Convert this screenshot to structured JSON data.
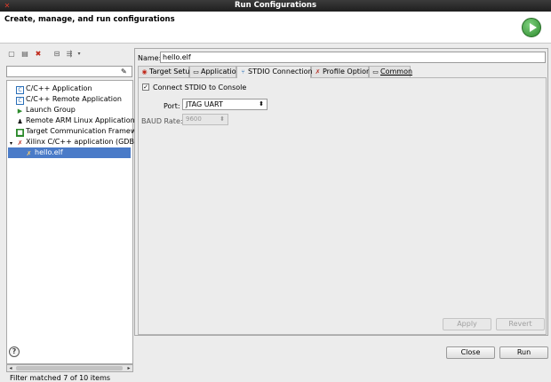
{
  "window": {
    "title": "Run Configurations"
  },
  "banner": {
    "heading": "Create, manage, and run configurations"
  },
  "filter": {
    "value": "",
    "status": "Filter matched 7 of 10 items"
  },
  "tree": {
    "items": [
      {
        "label": "C/C++ Application",
        "icon": "c-app-icon"
      },
      {
        "label": "C/C++ Remote Application",
        "icon": "c-remote-app-icon"
      },
      {
        "label": "Launch Group",
        "icon": "launch-group-icon"
      },
      {
        "label": "Remote ARM Linux Application",
        "icon": "linux-penguin-icon"
      },
      {
        "label": "Target Communication Framework",
        "icon": "tcf-icon"
      },
      {
        "label": "Xilinx C/C++ application (GDB)",
        "icon": "xilinx-app-icon"
      },
      {
        "label": "hello.elf",
        "icon": "config-icon",
        "selected": true
      }
    ]
  },
  "config": {
    "name_label": "Name:",
    "name_value": "hello.elf",
    "tabs": [
      {
        "label": "Target Setup",
        "icon": "target-icon"
      },
      {
        "label": "Application",
        "icon": "application-icon"
      },
      {
        "label": "STDIO Connection",
        "icon": "stdio-icon",
        "active": true
      },
      {
        "label": "Profile Options",
        "icon": "profile-icon"
      },
      {
        "label": "Common",
        "icon": "common-icon"
      }
    ],
    "stdio": {
      "connect_label": "Connect STDIO to Console",
      "connect_checked": true,
      "port_label": "Port:",
      "port_value": "JTAG UART",
      "baud_label": "BAUD Rate:",
      "baud_value": "9600"
    },
    "apply_label": "Apply",
    "revert_label": "Revert"
  },
  "footer": {
    "close_label": "Close",
    "run_label": "Run"
  }
}
